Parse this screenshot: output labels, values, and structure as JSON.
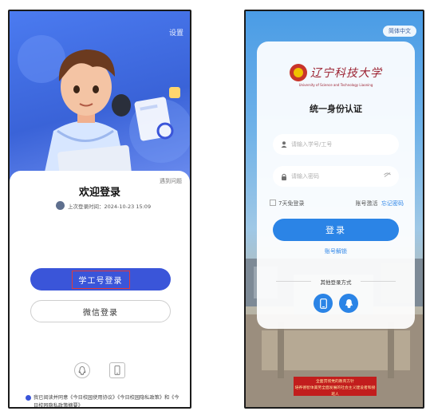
{
  "left": {
    "corner_label": "设置",
    "help_link": "遇到问题",
    "welcome_title": "欢迎登录",
    "last_login": "上次登录时间：2024-10-23 15:09",
    "primary_button": "学工号登录",
    "secondary_button": "微信登录",
    "agreement": "我已阅读并同意《今日校园使用协议》《今日校园隐私政策》和《今日校园隐私政策摘要》",
    "bottom_icons": [
      "qq-icon",
      "phone-icon"
    ],
    "accent": "#3a55d9"
  },
  "right": {
    "language": "简体中文",
    "university": "辽宁科技大学",
    "university_en": "University of Science and Technology Liaoning",
    "title": "统一身份认证",
    "username_placeholder": "请输入学号/工号",
    "password_placeholder": "请输入密码",
    "remember": "7天免登录",
    "activate": "账号激活",
    "forgot": "忘记密码",
    "login_button": "登录",
    "unlock": "账号解锁",
    "other_methods": "其他登录方式",
    "banner_line1": "全面贯彻党的教育方针",
    "banner_line2": "培养德智体美劳全面发展的社会主义建设者和接班人",
    "accent": "#2b84e6"
  }
}
